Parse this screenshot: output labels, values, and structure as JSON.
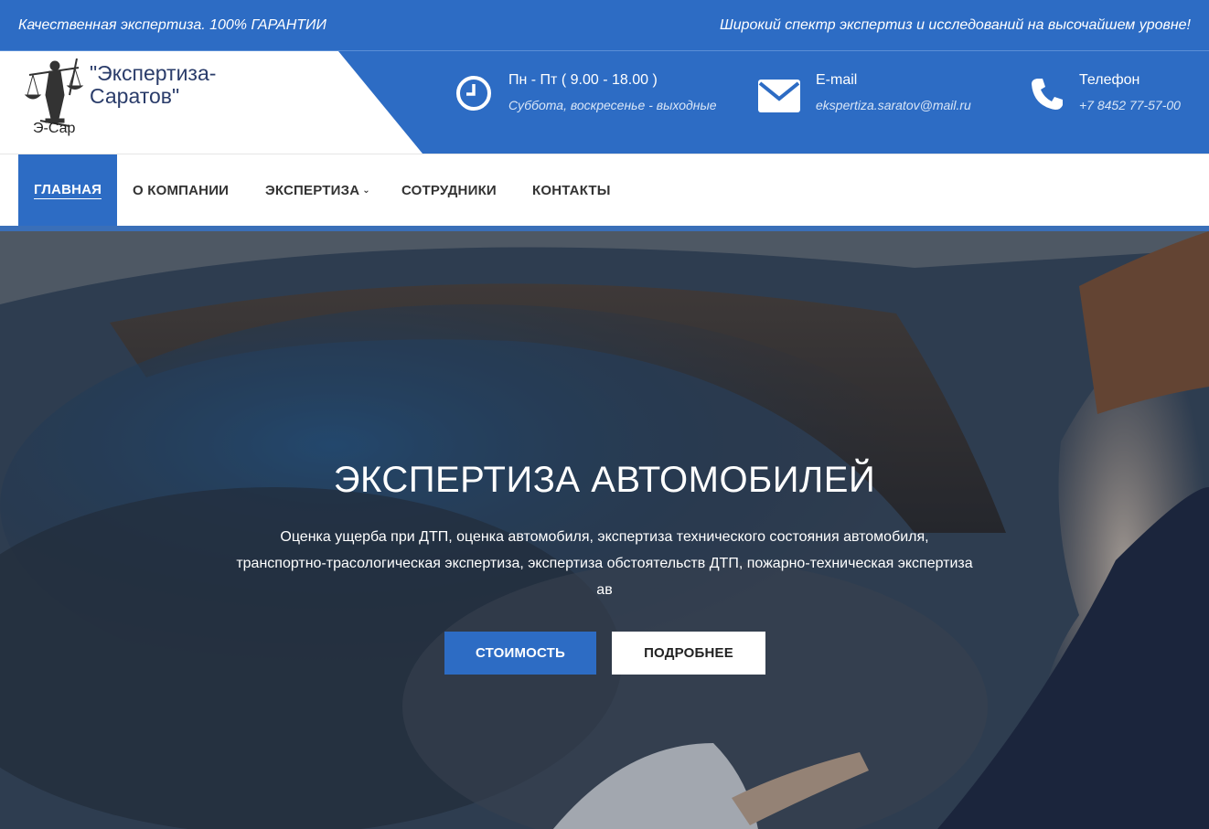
{
  "topbar": {
    "left_text": "Качественная экспертиза. 100% ГАРАНТИИ",
    "right_text": "Широкий спектр экспертиз и исследований на высочайшем уровне!"
  },
  "brand": {
    "name": "\"Экспертиза-Саратов\"",
    "short": "Э-Сар",
    "logo_icon": "justice-statue-icon"
  },
  "header_info": [
    {
      "icon": "clock-icon",
      "title": "Пн - Пт ( 9.00 - 18.00 )",
      "subtitle": "Суббота, воскресенье - выходные"
    },
    {
      "icon": "envelope-icon",
      "title": "E-mail",
      "subtitle": "ekspertiza.saratov@mail.ru"
    },
    {
      "icon": "phone-icon",
      "title": "Телефон",
      "subtitle": "+7 8452 77-57-00"
    }
  ],
  "nav": {
    "items": [
      {
        "label": "ГЛАВНАЯ",
        "active": true
      },
      {
        "label": "О КОМПАНИИ"
      },
      {
        "label": "ЭКСПЕРТИЗА",
        "has_dropdown": true
      },
      {
        "label": "СОТРУДНИКИ"
      },
      {
        "label": "КОНТАКТЫ"
      }
    ]
  },
  "hero": {
    "title": "ЭКСПЕРТИЗА АВТОМОБИЛЕЙ",
    "text": "Оценка ущерба при ДТП, оценка автомобиля, экспертиза технического состояния автомобиля, транспортно-трасологическая экспертиза, экспертиза обстоятельств ДТП, пожарно-техническая экспертиза ав",
    "primary_button": "СТОИМОСТЬ",
    "secondary_button": "ПОДРОБНЕЕ"
  },
  "colors": {
    "brand_blue": "#2d6cc4"
  }
}
